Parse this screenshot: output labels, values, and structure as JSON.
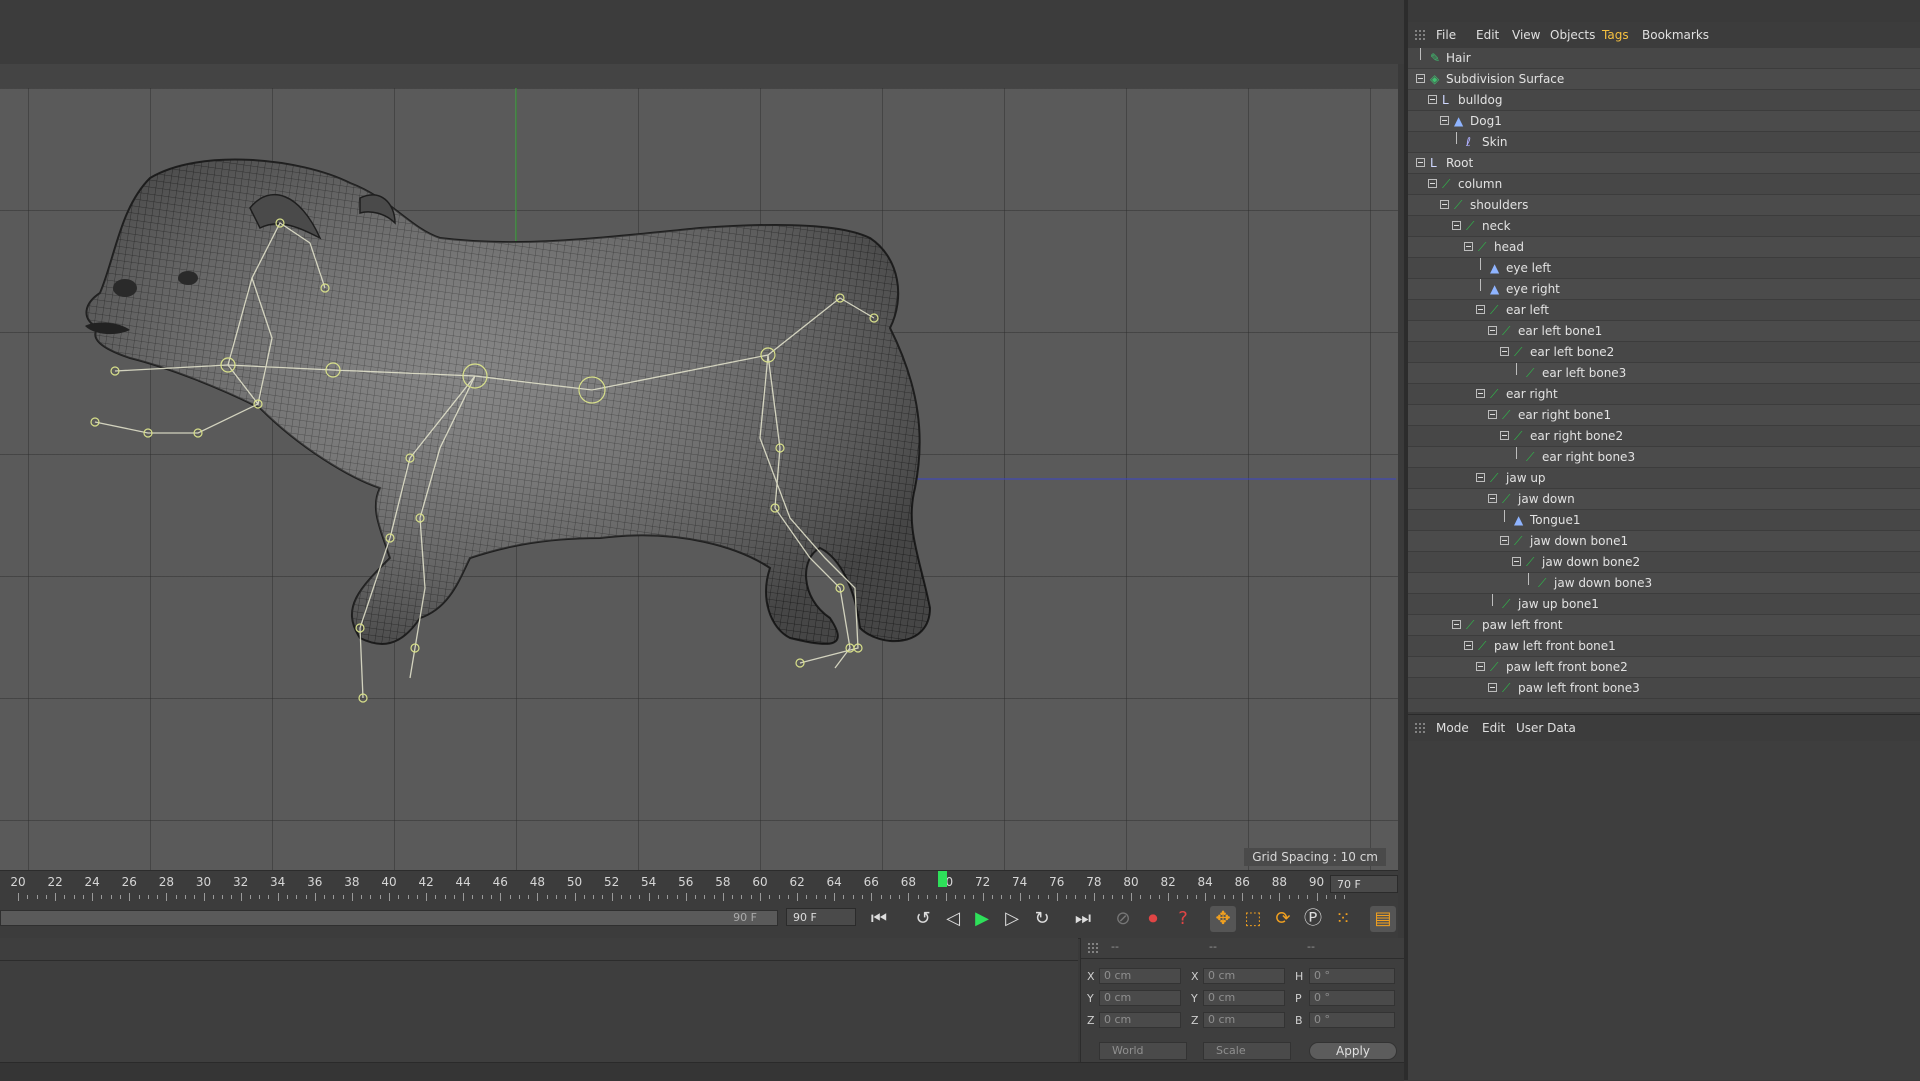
{
  "viewport": {
    "grid_spacing": "Grid Spacing : 10 cm",
    "nav_icons": [
      "move-icon",
      "zoom-icon",
      "rotate-icon",
      "maximize-icon"
    ]
  },
  "timeline": {
    "ticks": [
      "20",
      "22",
      "24",
      "26",
      "28",
      "30",
      "32",
      "34",
      "36",
      "38",
      "40",
      "42",
      "44",
      "46",
      "48",
      "50",
      "52",
      "54",
      "56",
      "58",
      "60",
      "62",
      "64",
      "66",
      "68",
      "70",
      "72",
      "74",
      "76",
      "78",
      "80",
      "82",
      "84",
      "86",
      "88",
      "90"
    ],
    "current_frame": "70",
    "end_frame": "70 F"
  },
  "transport": {
    "range_label": "90 F",
    "range_input": "90 F",
    "buttons": [
      "go-to-start",
      "previous-key",
      "previous-frame",
      "play-forward",
      "next-frame",
      "next-key",
      "go-to-end"
    ]
  },
  "coordinates": {
    "headers": [
      "--",
      "--",
      "--"
    ],
    "rows": [
      {
        "a1": "X",
        "v1": "0 cm",
        "a2": "X",
        "v2": "0 cm",
        "a3": "H",
        "v3": "0 °"
      },
      {
        "a1": "Y",
        "v1": "0 cm",
        "a2": "Y",
        "v2": "0 cm",
        "a3": "P",
        "v3": "0 °"
      },
      {
        "a1": "Z",
        "v1": "0 cm",
        "a2": "Z",
        "v2": "0 cm",
        "a3": "B",
        "v3": "0 °"
      }
    ],
    "mode_select": "World",
    "size_select": "Scale",
    "apply_label": "Apply"
  },
  "object_manager": {
    "menu": [
      "File",
      "Edit",
      "View",
      "Objects",
      "Tags",
      "Bookmarks"
    ],
    "items": [
      {
        "label": "Hair",
        "depth": 0,
        "icon": "hair",
        "expand": false
      },
      {
        "label": "Subdivision Surface",
        "depth": 0,
        "icon": "subdivision",
        "expand": true
      },
      {
        "label": "bulldog",
        "depth": 1,
        "icon": "null",
        "expand": true
      },
      {
        "label": "Dog1",
        "depth": 2,
        "icon": "mesh",
        "expand": true
      },
      {
        "label": "Skin",
        "depth": 3,
        "icon": "skin",
        "expand": false
      },
      {
        "label": "Root",
        "depth": 0,
        "icon": "null",
        "expand": true
      },
      {
        "label": "column",
        "depth": 1,
        "icon": "joint",
        "expand": true
      },
      {
        "label": "shoulders",
        "depth": 2,
        "icon": "joint",
        "expand": true
      },
      {
        "label": "neck",
        "depth": 3,
        "icon": "joint",
        "expand": true
      },
      {
        "label": "head",
        "depth": 4,
        "icon": "joint",
        "expand": true
      },
      {
        "label": "eye left",
        "depth": 5,
        "icon": "mesh",
        "expand": false
      },
      {
        "label": "eye right",
        "depth": 5,
        "icon": "mesh",
        "expand": false
      },
      {
        "label": "ear left",
        "depth": 5,
        "icon": "joint",
        "expand": true
      },
      {
        "label": "ear left bone1",
        "depth": 6,
        "icon": "joint",
        "expand": true
      },
      {
        "label": "ear left bone2",
        "depth": 7,
        "icon": "joint",
        "expand": true
      },
      {
        "label": "ear left bone3",
        "depth": 8,
        "icon": "joint",
        "expand": false
      },
      {
        "label": "ear right",
        "depth": 5,
        "icon": "joint",
        "expand": true
      },
      {
        "label": "ear right bone1",
        "depth": 6,
        "icon": "joint",
        "expand": true
      },
      {
        "label": "ear right bone2",
        "depth": 7,
        "icon": "joint",
        "expand": true
      },
      {
        "label": "ear right bone3",
        "depth": 8,
        "icon": "joint",
        "expand": false
      },
      {
        "label": "jaw up",
        "depth": 5,
        "icon": "joint",
        "expand": true
      },
      {
        "label": "jaw down",
        "depth": 6,
        "icon": "joint",
        "expand": true
      },
      {
        "label": "Tongue1",
        "depth": 7,
        "icon": "mesh",
        "expand": false
      },
      {
        "label": "jaw down bone1",
        "depth": 7,
        "icon": "joint",
        "expand": true
      },
      {
        "label": "jaw down bone2",
        "depth": 8,
        "icon": "joint",
        "expand": true
      },
      {
        "label": "jaw down bone3",
        "depth": 9,
        "icon": "joint",
        "expand": false
      },
      {
        "label": "jaw up bone1",
        "depth": 6,
        "icon": "joint",
        "expand": false
      },
      {
        "label": "paw left front",
        "depth": 3,
        "icon": "joint",
        "expand": true
      },
      {
        "label": "paw left front  bone1",
        "depth": 4,
        "icon": "joint",
        "expand": true
      },
      {
        "label": "paw left front  bone2",
        "depth": 5,
        "icon": "joint",
        "expand": true
      },
      {
        "label": "paw left front  bone3",
        "depth": 6,
        "icon": "joint",
        "expand": true
      }
    ]
  },
  "attribute_manager": {
    "menu": [
      "Mode",
      "Edit",
      "User Data"
    ]
  },
  "colors": {
    "playhead": "#2ee05a",
    "y_axis": "#3fae3f",
    "x_axis": "#3a44c8",
    "joint": "#2fb84a",
    "bone": "#e8e8d0"
  }
}
